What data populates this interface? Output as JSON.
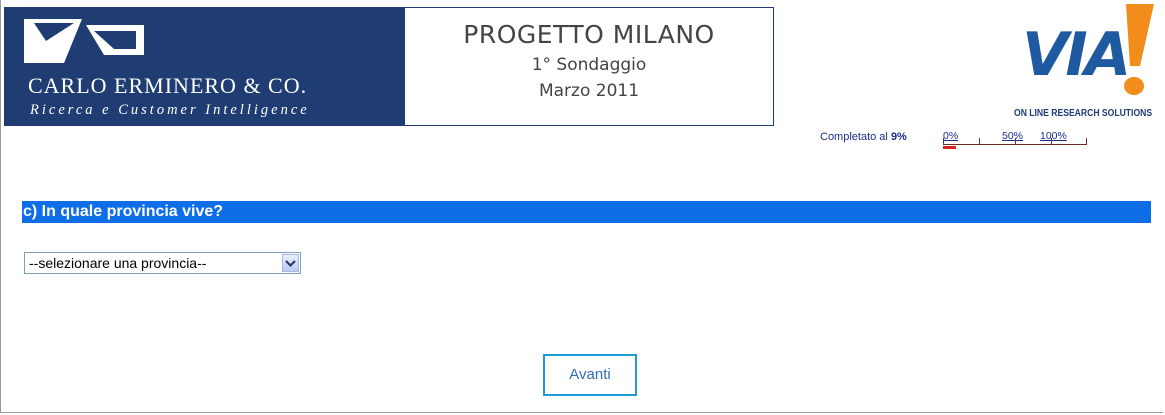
{
  "header": {
    "company_name": "CARLO ERMINERO & CO.",
    "company_tagline": "Ricerca e Customer Intelligence",
    "project_title": "PROGETTO MILANO",
    "survey_name": "1° Sondaggio",
    "survey_date": "Marzo 2011",
    "partner_logo_text": "VIA",
    "partner_tagline": "ON LINE RESEARCH SOLUTIONS"
  },
  "progress": {
    "label": "Completato al",
    "percent_text": "9%",
    "value": 0.09,
    "scale_labels": [
      "0%",
      "50%",
      "100%"
    ]
  },
  "question": {
    "text": "c) In quale provincia vive?"
  },
  "province_select": {
    "selected": "--selezionare una provincia--"
  },
  "next_button": {
    "label": "Avanti"
  },
  "colors": {
    "brand_navy": "#1f3c73",
    "question_bar": "#0d6ee8",
    "via_blue": "#1e5aa0",
    "via_orange": "#f28c1a",
    "progress_fill": "#e02020",
    "button_border": "#1d9bd6"
  }
}
